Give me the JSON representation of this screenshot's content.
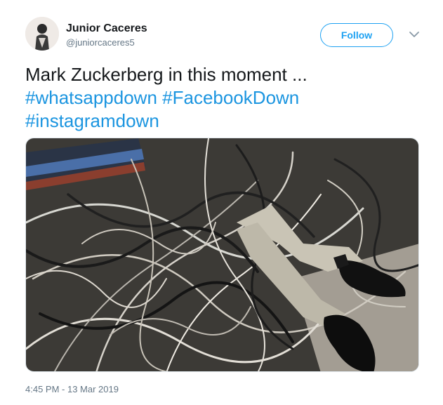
{
  "user": {
    "display_name": "Junior Caceres",
    "handle": "@juniorcaceres5"
  },
  "follow_label": "Follow",
  "tweet": {
    "text": "Mark Zuckerberg in this moment ...",
    "hashtags": [
      "#whatsappdown",
      "#FacebookDown",
      "#instagramdown"
    ]
  },
  "timestamp": "4:45 PM - 13 Mar 2019",
  "icons": {
    "caret": "chevron-down-icon",
    "avatar": "avatar"
  },
  "colors": {
    "accent": "#1da1f2",
    "hashtag": "#1b95e0",
    "secondary_text": "#657786"
  }
}
